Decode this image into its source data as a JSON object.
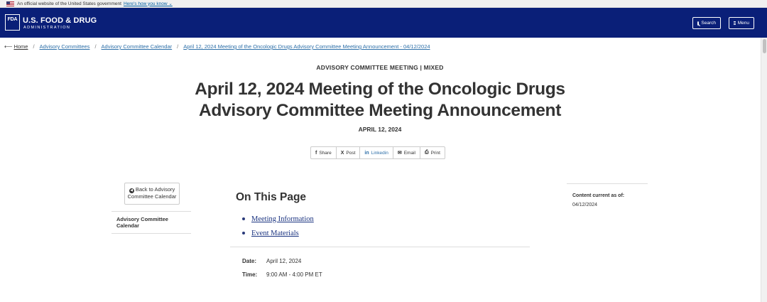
{
  "gov_banner": {
    "text": "An official website of the United States government",
    "link": "Here's how you know"
  },
  "header": {
    "logo_text": "FDA",
    "brand_name": "U.S. FOOD & DRUG",
    "brand_sub": "ADMINISTRATION",
    "search_label": "Search",
    "menu_label": "Menu"
  },
  "breadcrumb": {
    "home": "Home",
    "items": [
      "Advisory Committees",
      "Advisory Committee Calendar",
      "April 12, 2024 Meeting of the Oncologic Drugs Advisory Committee Meeting Announcement - 04/12/2024"
    ],
    "separator": "/"
  },
  "page": {
    "eyebrow": "ADVISORY COMMITTEE MEETING | MIXED",
    "title_line1": "April 12, 2024 Meeting of the Oncologic Drugs",
    "title_line2": "Advisory Committee Meeting Announcement",
    "date": "APRIL 12, 2024"
  },
  "share": {
    "items": [
      {
        "icon": "f",
        "label": "Share"
      },
      {
        "icon": "X",
        "label": "Post"
      },
      {
        "icon": "in",
        "label": "Linkedin"
      },
      {
        "icon": "✉",
        "label": "Email"
      },
      {
        "icon": "⎙",
        "label": "Print"
      }
    ]
  },
  "sidebar": {
    "back_line1": "Back to Advisory",
    "back_line2": "Committee Calendar",
    "nav_item": "Advisory Committee Calendar"
  },
  "main": {
    "on_this_page": "On This Page",
    "toc": [
      "Meeting Information",
      "Event Materials"
    ],
    "date_label": "Date:",
    "date_value": "April 12, 2024",
    "time_label": "Time:",
    "time_value": "9:00 AM - 4:00 PM ET"
  },
  "aside": {
    "content_current_label": "Content current as of:",
    "content_current_date": "04/12/2024"
  }
}
